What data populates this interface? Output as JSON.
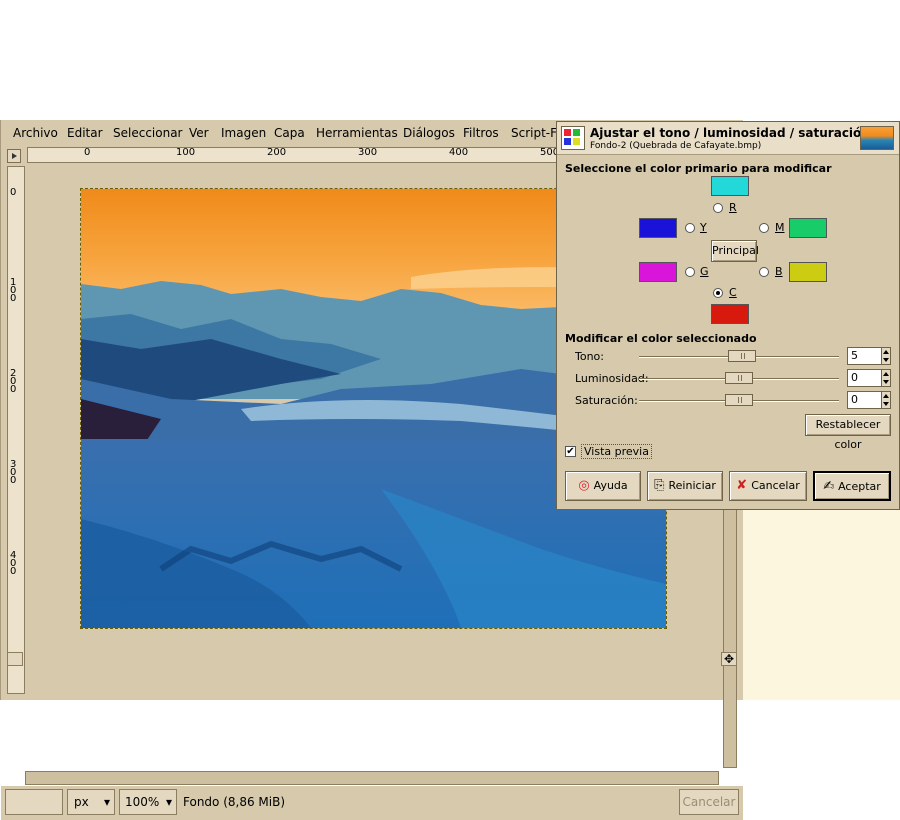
{
  "menu": [
    "Archivo",
    "Editar",
    "Seleccionar",
    "Ver",
    "Imagen",
    "Capa",
    "Herramientas",
    "Diálogos",
    "Filtros",
    "Script-F"
  ],
  "ruler": {
    "h": [
      "0",
      "100",
      "200",
      "300",
      "400",
      "500"
    ],
    "v": [
      "0",
      "100",
      "200",
      "300",
      "400"
    ]
  },
  "status": {
    "unit": "px",
    "zoom": "100%",
    "layer_info": "Fondo (8,86 MiB)",
    "cancel_label": "Cancelar"
  },
  "dialog": {
    "title": "Ajustar el tono / luminosidad / saturación",
    "subtitle": "Fondo-2 (Quebrada de Cafayate.bmp)",
    "primary_section": "Seleccione el color primario para modificar",
    "modify_section": "Modificar el color seleccionado",
    "colors": {
      "C_top": "#22d8d8",
      "B_left": "#1a12d8",
      "G_right": "#18cc6a",
      "M_left": "#d815d8",
      "Y_right": "#cccc12",
      "R_bottom": "#d81a0e"
    },
    "radio_labels": {
      "R": "R",
      "Y": "Y",
      "M": "M",
      "G": "G",
      "B": "B",
      "C": "C"
    },
    "selected_radio": "C",
    "principal_label": "Principal",
    "sliders": [
      {
        "label": "Tono:",
        "value": "5",
        "level": 5
      },
      {
        "label": "Luminosidad:",
        "value": "0",
        "level": 0
      },
      {
        "label": "Saturación:",
        "value": "0",
        "level": 0
      }
    ],
    "reset_color_label": "Restablecer color",
    "preview_label": "Vista previa",
    "preview_checked": true,
    "buttons": {
      "help": "Ayuda",
      "reset": "Reiniciar",
      "cancel": "Cancelar",
      "ok": "Aceptar"
    }
  }
}
